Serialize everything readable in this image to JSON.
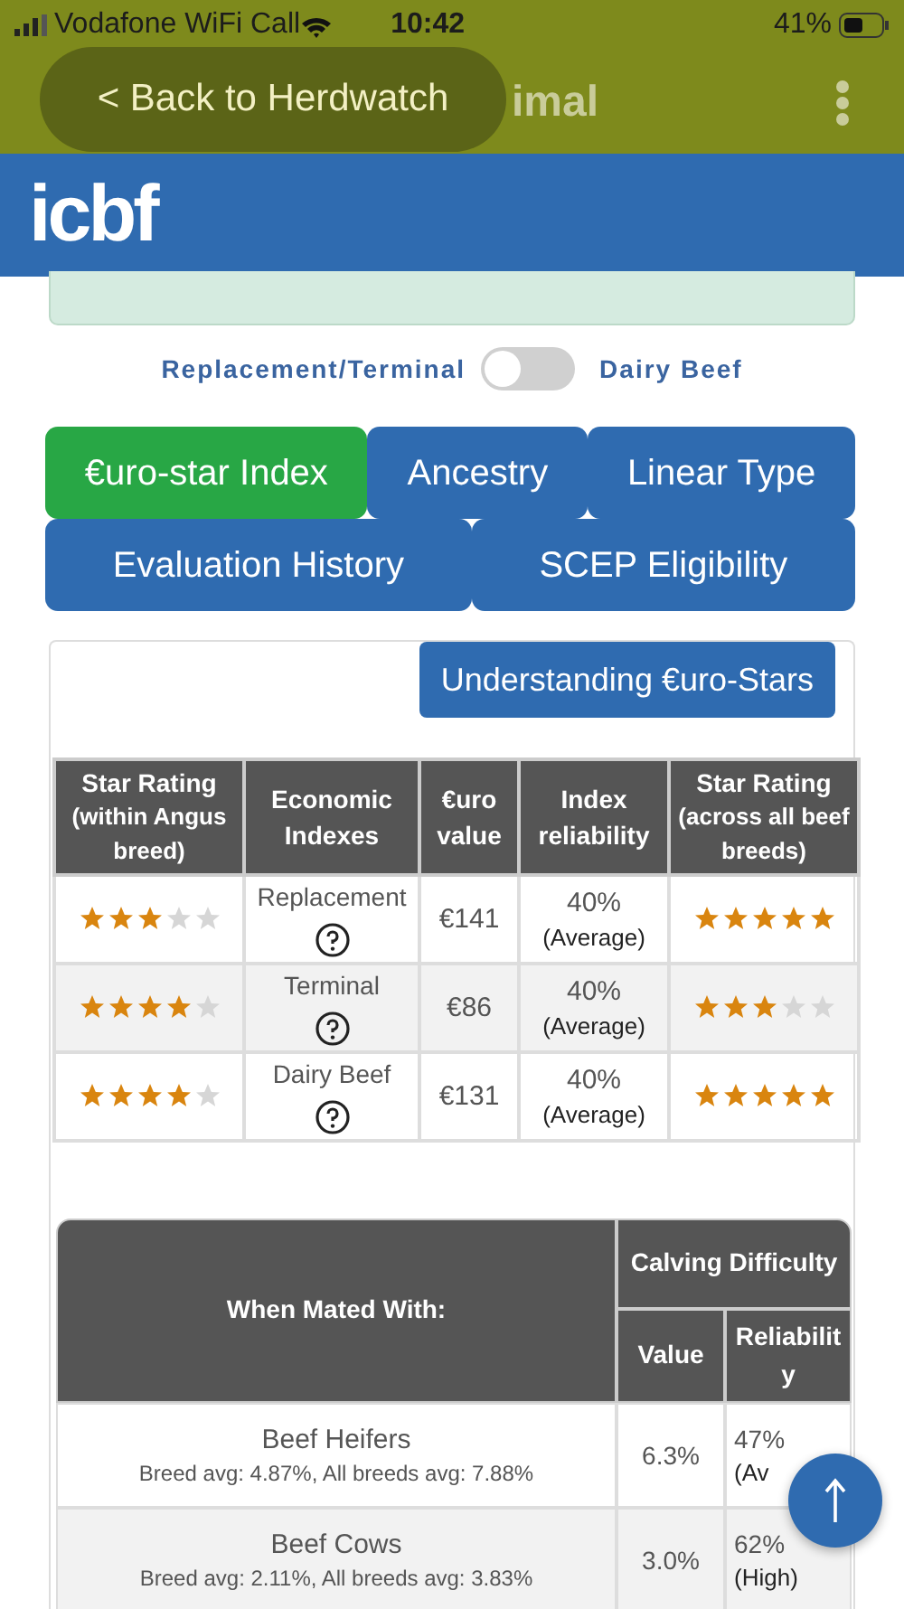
{
  "status_bar": {
    "carrier": "Vodafone WiFi Call",
    "time": "10:42",
    "battery": "41%"
  },
  "app_bar": {
    "title": "imal"
  },
  "back_button": "< Back to Herdwatch",
  "header": {
    "logo": "icbf"
  },
  "toggle": {
    "left_label": "Replacement/Terminal",
    "right_label": "Dairy Beef",
    "on": false
  },
  "tab_rows": [
    [
      {
        "label": "€uro-star Index",
        "selected": true
      },
      {
        "label": "Ancestry",
        "selected": false
      },
      {
        "label": "Linear Type",
        "selected": false
      }
    ],
    [
      {
        "label": "Evaluation History",
        "selected": false
      },
      {
        "label": "SCEP Eligibility",
        "selected": false
      }
    ]
  ],
  "understanding_button": "Understanding €uro-Stars",
  "index_table": {
    "columns": [
      {
        "title": "Star Rating",
        "subtitle": "(within Angus breed)"
      },
      {
        "title": "Economic Indexes"
      },
      {
        "title": "€uro value"
      },
      {
        "title": "Index reliability"
      },
      {
        "title": "Star Rating",
        "subtitle": "(across all beef breeds)"
      }
    ],
    "rows": [
      {
        "rating_within": {
          "stars": 3
        },
        "index": "Replacement",
        "value": "€141",
        "reliability": "40%",
        "reliability_label": "(Average)",
        "rating_across": {
          "stars": 5
        }
      },
      {
        "rating_within": {
          "stars": 4
        },
        "index": "Terminal",
        "value": "€86",
        "reliability": "40%",
        "reliability_label": "(Average)",
        "rating_across": {
          "stars": 3
        }
      },
      {
        "rating_within": {
          "stars": 4
        },
        "index": "Dairy Beef",
        "value": "€131",
        "reliability": "40%",
        "reliability_label": "(Average)",
        "rating_across": {
          "stars": 5
        }
      }
    ]
  },
  "calving_table": {
    "columns": {
      "mated_with": "When Mated With:",
      "group": "Calving Difficulty",
      "value": "Value",
      "reliability": "Reliabilit y"
    },
    "rows": [
      {
        "name": "Beef Heifers",
        "detail": "Breed avg: 4.87%, All breeds avg: 7.88%",
        "value": "6.3%",
        "reliability": "47%",
        "reliability_label": "(Av"
      },
      {
        "name": "Beef Cows",
        "detail": "Breed avg: 2.11%, All breeds avg: 3.83%",
        "value": "3.0%",
        "reliability": "62%",
        "reliability_label": "(High)"
      }
    ]
  }
}
